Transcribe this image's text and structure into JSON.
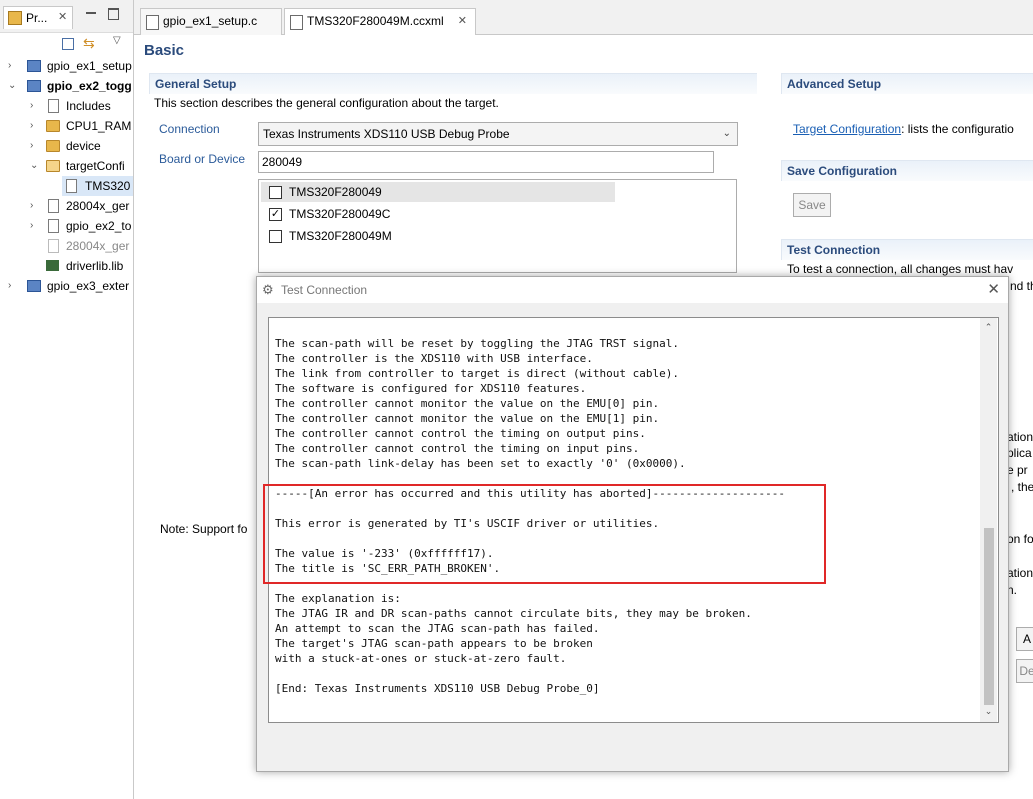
{
  "explorer": {
    "tab_label": "Pr...",
    "items": [
      {
        "label": "gpio_ex1_setup",
        "style": "normal"
      },
      {
        "label": "gpio_ex2_togg",
        "style": "bold"
      },
      {
        "label": "Includes"
      },
      {
        "label": "CPU1_RAM"
      },
      {
        "label": "device"
      },
      {
        "label": "targetConfi"
      },
      {
        "label": "TMS320"
      },
      {
        "label": "28004x_ger"
      },
      {
        "label": "gpio_ex2_to"
      },
      {
        "label": "28004x_ger",
        "style": "gray"
      },
      {
        "label": "driverlib.lib"
      },
      {
        "label": "gpio_ex3_exter"
      }
    ]
  },
  "editor": {
    "tabs": [
      {
        "label": "gpio_ex1_setup.c"
      },
      {
        "label": "TMS320F280049M.ccxml"
      }
    ],
    "basic_title": "Basic",
    "general_setup": {
      "header": "General Setup",
      "description": "This section describes the general configuration about the target.",
      "connection_label": "Connection",
      "connection_value": "Texas Instruments XDS110 USB Debug Probe",
      "board_label": "Board or Device",
      "board_value": "280049",
      "devices": [
        {
          "name": "TMS320F280049",
          "checked": false
        },
        {
          "name": "TMS320F280049C",
          "checked": true
        },
        {
          "name": "TMS320F280049M",
          "checked": false
        }
      ],
      "note": "Note: Support fo"
    },
    "advanced_setup": {
      "header": "Advanced Setup",
      "link": "Target Configuration",
      "link_suffix": ": lists the configuratio"
    },
    "save_configuration": {
      "header": "Save Configuration",
      "save_button": "Save"
    },
    "test_connection": {
      "header": "Test Connection",
      "line1": "To test a connection, all changes must hav",
      "line2": "nd th"
    },
    "right_fragments": [
      "ation",
      "plica",
      "e pr",
      ", the",
      "on fo",
      "ation",
      "n.",
      "A",
      "De"
    ]
  },
  "dialog": {
    "title": "Test Connection",
    "console_lines": [
      "The scan-path will be reset by toggling the JTAG TRST signal.",
      "The controller is the XDS110 with USB interface.",
      "The link from controller to target is direct (without cable).",
      "The software is configured for XDS110 features.",
      "The controller cannot monitor the value on the EMU[0] pin.",
      "The controller cannot monitor the value on the EMU[1] pin.",
      "The controller cannot control the timing on output pins.",
      "The controller cannot control the timing on input pins.",
      "The scan-path link-delay has been set to exactly '0' (0x0000).",
      "",
      "-----[An error has occurred and this utility has aborted]--------------------",
      "",
      "This error is generated by TI's USCIF driver or utilities.",
      "",
      "The value is '-233' (0xffffff17).",
      "The title is 'SC_ERR_PATH_BROKEN'.",
      "",
      "The explanation is:",
      "The JTAG IR and DR scan-paths cannot circulate bits, they may be broken.",
      "An attempt to scan the JTAG scan-path has failed.",
      "The target's JTAG scan-path appears to be broken",
      "with a stuck-at-ones or stuck-at-zero fault.",
      "",
      "[End: Texas Instruments XDS110 USB Debug Probe_0]"
    ]
  },
  "icons": [
    "project-explorer-icon",
    "close-icon",
    "minimize-icon",
    "maximize-icon",
    "collapse-all-icon",
    "link-editor-icon",
    "view-menu-icon",
    "checkbox-icon",
    "dropdown-arrow-icon",
    "dialog-app-icon",
    "scroll-up-icon",
    "scroll-down-icon"
  ],
  "colors": {
    "section_header_text": "#2b4b7c",
    "link": "#1a5fb4",
    "error_highlight": "#e02828"
  }
}
